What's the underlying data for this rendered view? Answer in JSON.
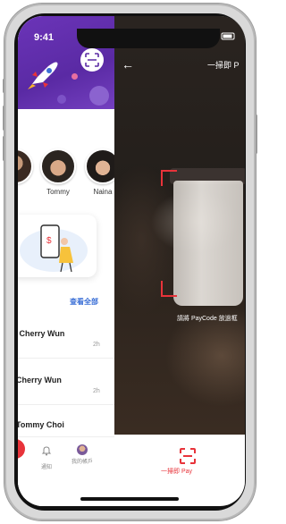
{
  "status": {
    "time": "9:41"
  },
  "left_panel": {
    "friends": [
      {
        "name": "Tommy"
      },
      {
        "name": "Naina"
      }
    ],
    "see_all_label": "查看全部",
    "conversations": [
      {
        "name": "s Cherry Wun",
        "time": "2h"
      },
      {
        "name": "Cherry Wun",
        "time": "2h"
      },
      {
        "name": "Tommy Choi",
        "time": ""
      }
    ],
    "tabs": [
      {
        "label": "通知",
        "icon": "bell-icon"
      },
      {
        "label": "我的帳戶",
        "icon": "avatar-icon"
      }
    ]
  },
  "scan_panel": {
    "title": "一掃即 P",
    "hint": "請將 PayCode 放過框",
    "bottom_label": "一掃即 Pay",
    "accent_color": "#e8333a"
  },
  "theme": {
    "hero_purple": "#5a2aa4",
    "link_blue": "#3b6fd6"
  }
}
